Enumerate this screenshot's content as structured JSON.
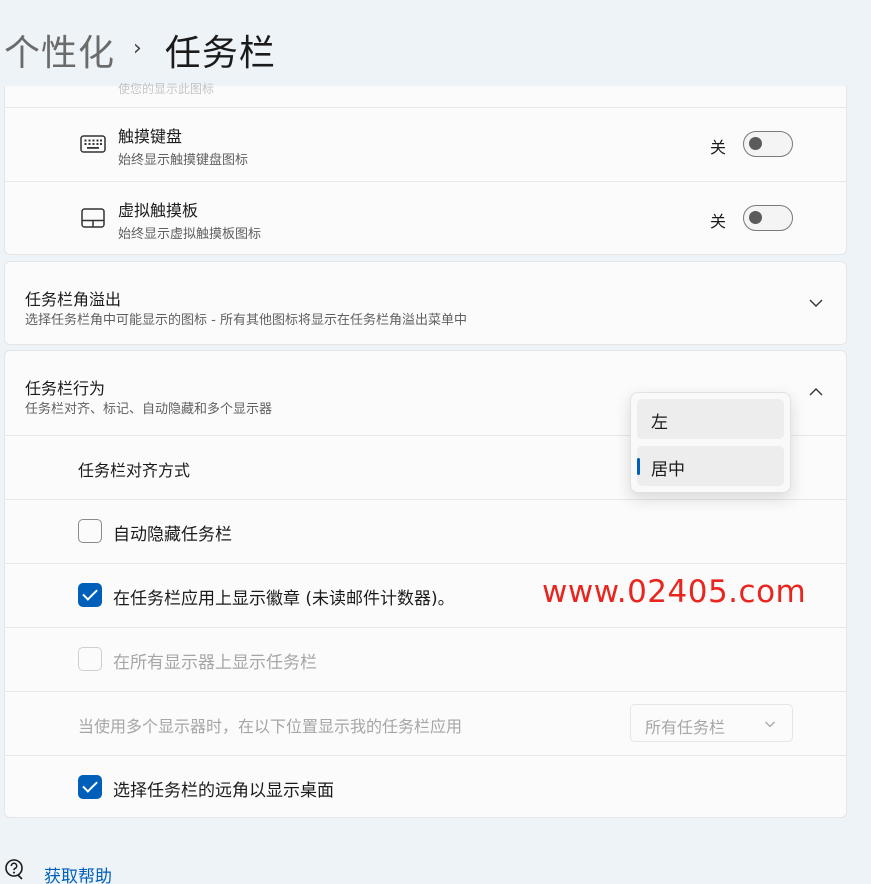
{
  "breadcrumb": {
    "parent": "个性化",
    "separator": "›",
    "current": "任务栏"
  },
  "corner_icons": {
    "clipped_sub": "使您的显示此图标",
    "touch_keyboard": {
      "icon": "keyboard-icon",
      "title": "触摸键盘",
      "subtitle": "始终显示触摸键盘图标",
      "state_label": "关",
      "on": false
    },
    "virtual_touchpad": {
      "icon": "touchpad-icon",
      "title": "虚拟触摸板",
      "subtitle": "始终显示虚拟触摸板图标",
      "state_label": "关",
      "on": false
    }
  },
  "overflow": {
    "title": "任务栏角溢出",
    "subtitle": "选择任务栏角中可能显示的图标 - 所有其他图标将显示在任务栏角溢出菜单中"
  },
  "behavior": {
    "title": "任务栏行为",
    "subtitle": "任务栏对齐、标记、自动隐藏和多个显示器",
    "alignment_label": "任务栏对齐方式",
    "alignment_options": [
      "左",
      "居中"
    ],
    "alignment_selected": "居中",
    "auto_hide": {
      "label": "自动隐藏任务栏",
      "checked": false
    },
    "badges": {
      "label": "在任务栏应用上显示徽章 (未读邮件计数器)。",
      "checked": true
    },
    "all_displays": {
      "label": "在所有显示器上显示任务栏",
      "checked": false,
      "disabled": true
    },
    "multi_display": {
      "label": "当使用多个显示器时，在以下位置显示我的任务栏应用",
      "value": "所有任务栏"
    },
    "far_corner": {
      "label": "选择任务栏的远角以显示桌面",
      "checked": true
    }
  },
  "watermark": "www.02405.com",
  "help": {
    "icon": "help-icon",
    "label": "获取帮助"
  },
  "colors": {
    "accent": "#005fb8",
    "background": "#eef3f8",
    "card": "#fbfbfb",
    "watermark": "#e8261f"
  }
}
